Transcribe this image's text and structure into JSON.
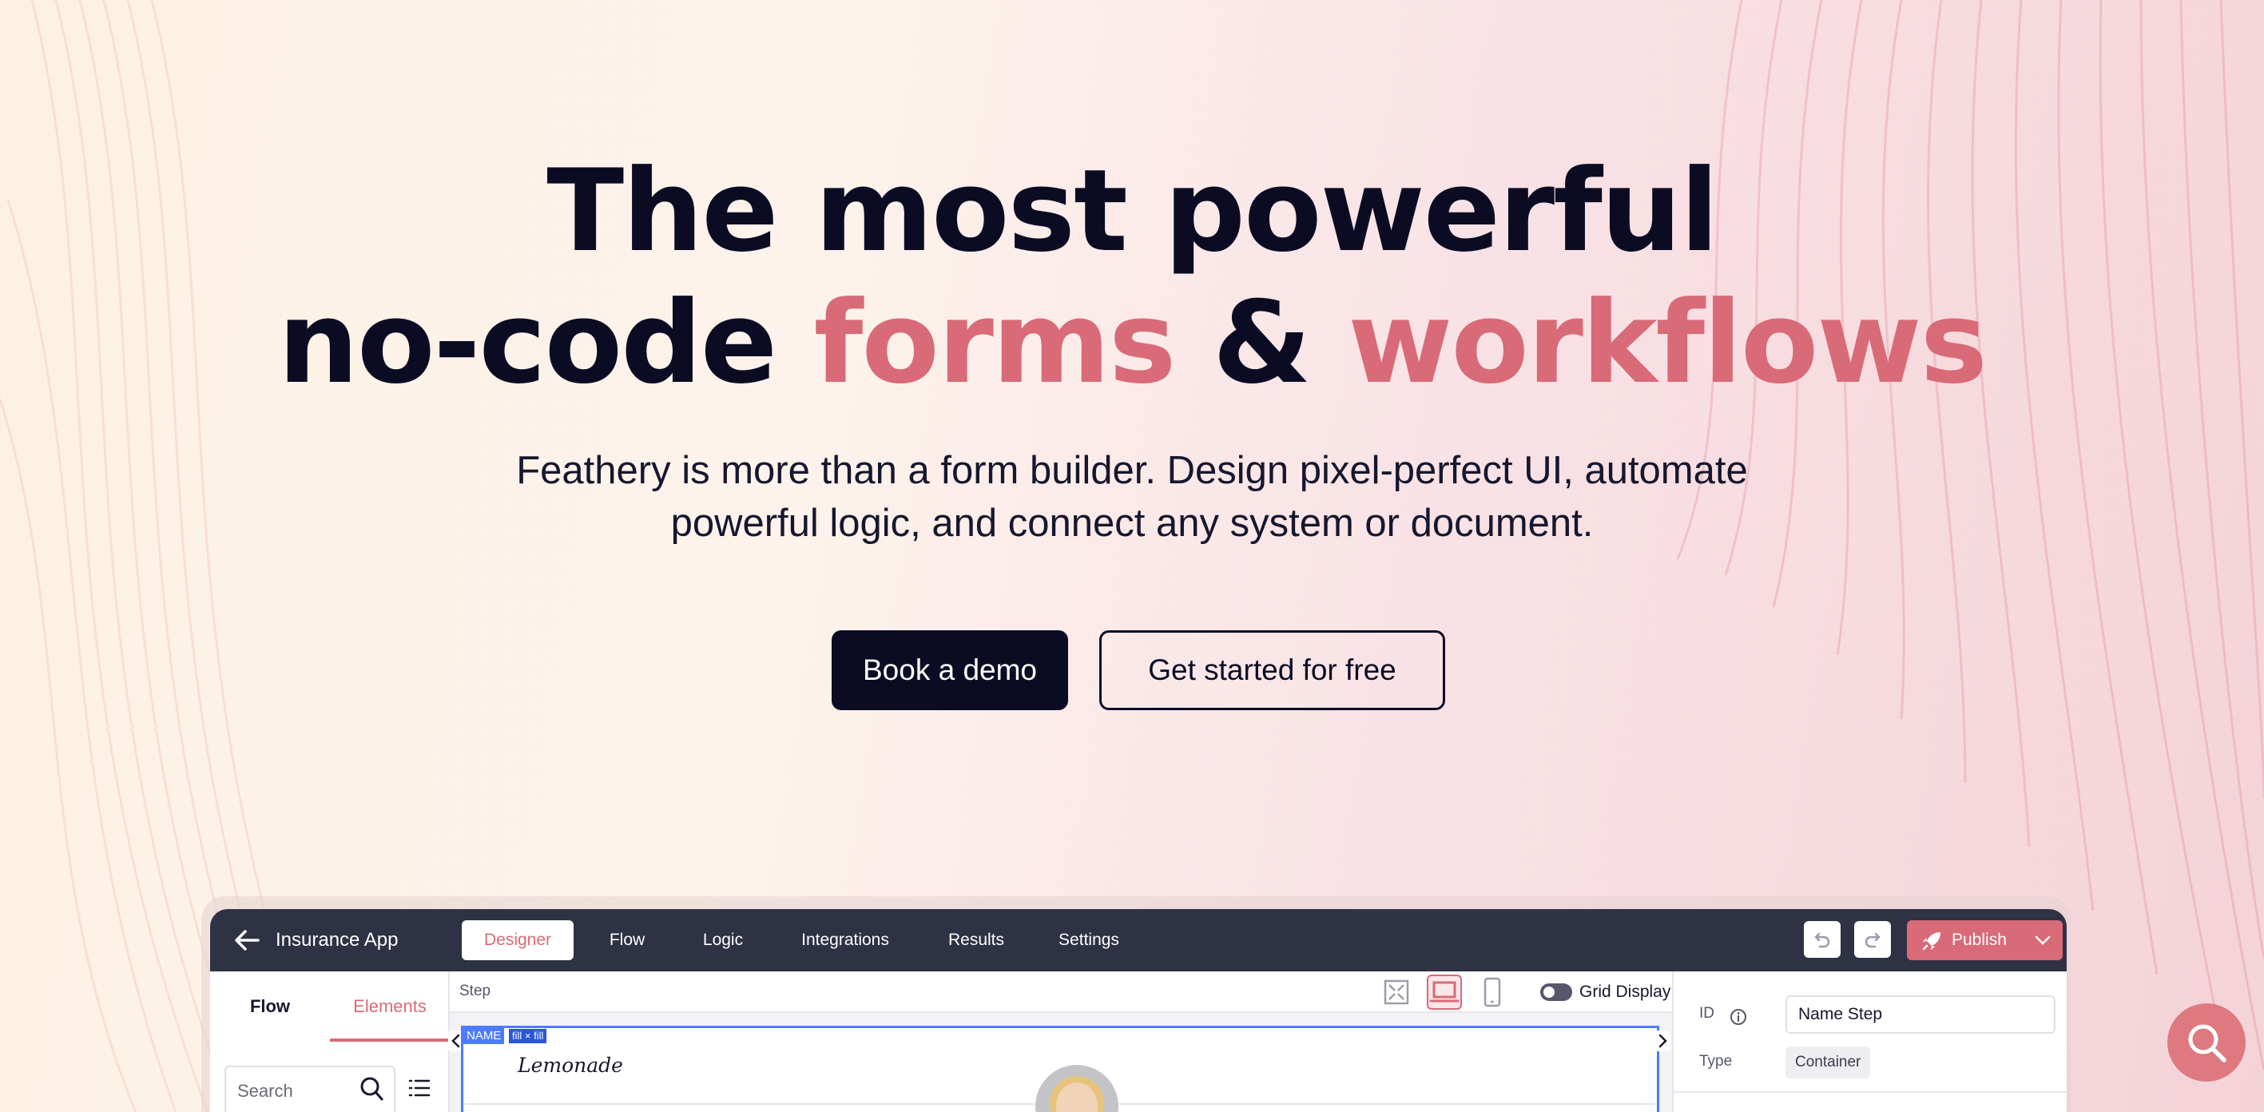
{
  "hero": {
    "headline_line1": "The most powerful",
    "headline_line2_part1": "no-code ",
    "headline_line2_accent1": "forms",
    "headline_line2_part2": " & ",
    "headline_line2_accent2": "workflows",
    "subtitle_line1": "Feathery is more than a form builder. Design pixel-perfect UI, automate",
    "subtitle_line2": "powerful logic, and connect any system or document.",
    "cta_primary": "Book a demo",
    "cta_secondary": "Get started for free"
  },
  "colors": {
    "accent": "#d86b77",
    "dark": "#0b0c24",
    "app_topbar": "#2e3244",
    "selection_blue": "#4d7bff"
  },
  "app": {
    "title": "Insurance App",
    "tabs": [
      {
        "label": "Designer",
        "active": true
      },
      {
        "label": "Flow",
        "active": false
      },
      {
        "label": "Logic",
        "active": false
      },
      {
        "label": "Integrations",
        "active": false
      },
      {
        "label": "Results",
        "active": false
      },
      {
        "label": "Settings",
        "active": false
      }
    ],
    "publish_label": "Publish",
    "left_panel": {
      "tab_flow": "Flow",
      "tab_elements": "Elements",
      "search_placeholder": "Search"
    },
    "canvas": {
      "step_label": "Step",
      "grid_display_label": "Grid Display",
      "name_tag": "NAME",
      "fill_tag": "fill × fill",
      "logo_text": "Lemonade"
    },
    "right_panel": {
      "id_label": "ID",
      "id_value": "Name Step",
      "type_label": "Type",
      "type_value": "Container"
    }
  },
  "icons": [
    "back-arrow-icon",
    "undo-icon",
    "redo-icon",
    "rocket-icon",
    "chevron-down-icon",
    "search-icon",
    "list-icon",
    "fullscreen-icon",
    "desktop-icon",
    "mobile-icon",
    "info-icon",
    "chevron-left-icon",
    "chevron-right-icon",
    "search-fab-icon"
  ]
}
